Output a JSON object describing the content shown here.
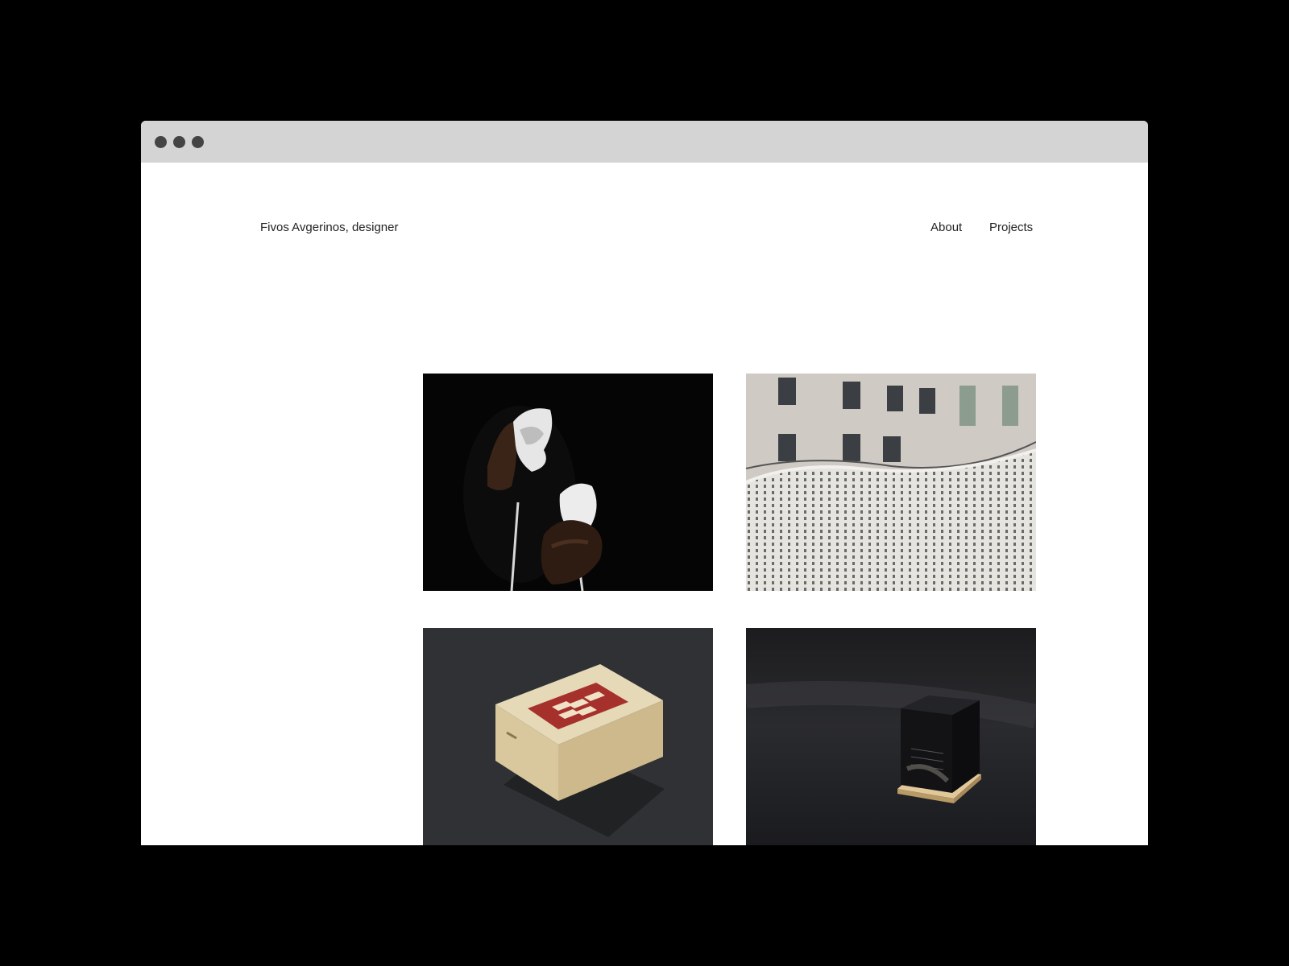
{
  "header": {
    "site_title": "Fivos Avgerinos, designer",
    "nav": [
      {
        "label": "About"
      },
      {
        "label": "Projects"
      }
    ]
  },
  "projects": [
    {
      "subject": "hands holding white 3D-printed rock objects on black background"
    },
    {
      "subject": "white perforated wave installation in front of neoclassical building"
    },
    {
      "subject": "wooden box with red printed lid on dark floor"
    },
    {
      "subject": "dark translucent cube on wooden base"
    }
  ],
  "colors": {
    "page_background": "#000000",
    "window_background": "#ffffff",
    "titlebar": "#d4d4d4",
    "window_dots": "#444444",
    "text": "#222222"
  }
}
